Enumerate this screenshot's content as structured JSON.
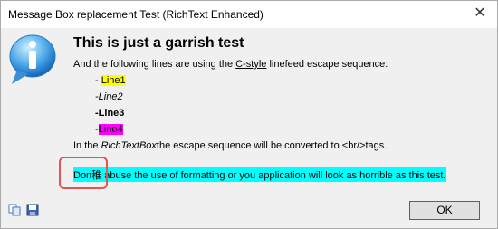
{
  "window": {
    "title": "Message Box replacement Test (RichText Enhanced)",
    "close_glyph": "✕"
  },
  "icons": {
    "main": "info-icon",
    "copy": "copy-icon",
    "save": "save-icon"
  },
  "message": {
    "heading": "This is just a garrish test",
    "intro_before": "And the following lines are using the ",
    "intro_link": "C-style",
    "intro_after": " linefeed escape sequence:",
    "lines": [
      {
        "prefix": "- ",
        "text": "Line1"
      },
      {
        "prefix": "-",
        "text": "Line2"
      },
      {
        "prefix": "-",
        "text": "Line3"
      },
      {
        "prefix": "-",
        "text": "Line4"
      }
    ],
    "escape_before": "In the ",
    "escape_italic": "RichTextBox",
    "escape_after": "the escape sequence will be converted to <br/>tags.",
    "warning": "Don稚 abuse the use of formatting or you application will look as horrible as this test."
  },
  "buttons": {
    "ok": "OK"
  },
  "colors": {
    "highlight_yellow": "#ffff00",
    "highlight_magenta": "#ff00ff",
    "highlight_cyan": "#00ffff",
    "marker_red": "#e05555"
  }
}
